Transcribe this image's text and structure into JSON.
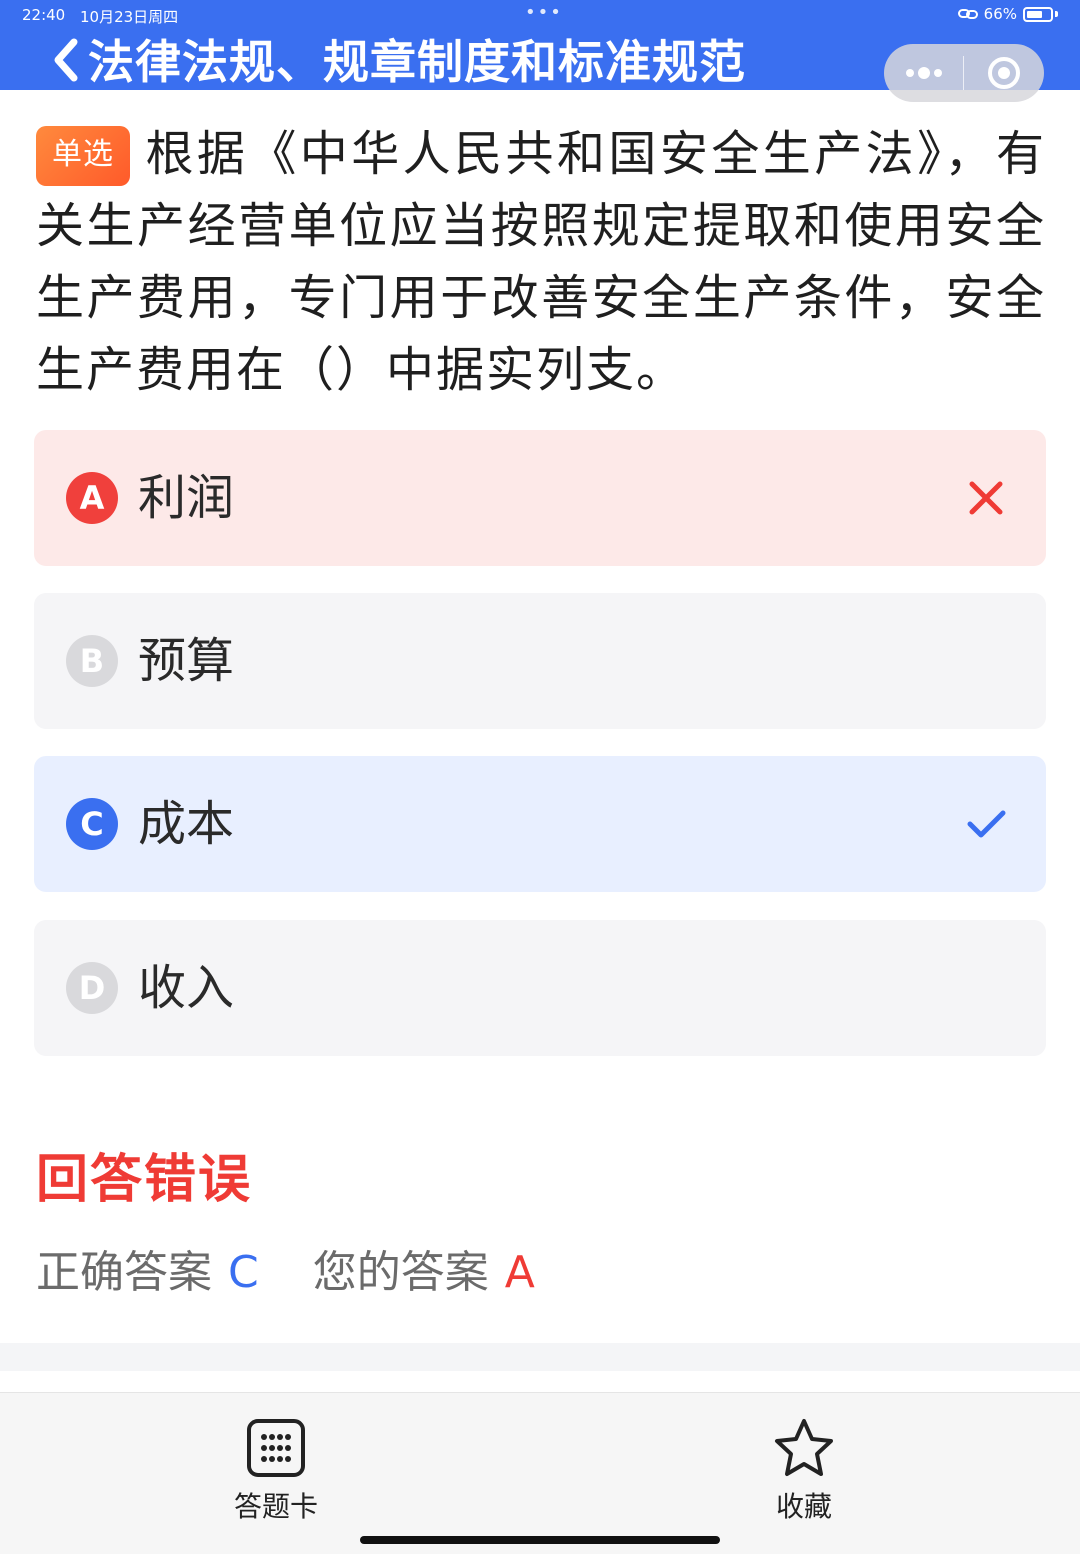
{
  "status_bar": {
    "time": "22:40",
    "date": "10月23日周四",
    "battery": "66%",
    "battery_level": 0.66
  },
  "header": {
    "title": "法律法规、规章制度和标准规范",
    "back_icon": "chevron-left-icon",
    "more_icon": "more-dots-icon",
    "close_icon": "target-close-icon"
  },
  "question": {
    "type_badge": "单选",
    "text": "根据《中华人民共和国安全生产法》，有关生产经营单位应当按照规定提取和使用安全生产费用，专门用于改善安全生产条件，安全生产费用在（）中据实列支。"
  },
  "options": [
    {
      "letter": "A",
      "text": "利润",
      "state": "wrong"
    },
    {
      "letter": "B",
      "text": "预算",
      "state": "normal"
    },
    {
      "letter": "C",
      "text": "成本",
      "state": "correct"
    },
    {
      "letter": "D",
      "text": "收入",
      "state": "normal"
    }
  ],
  "result": {
    "title": "回答错误",
    "correct_label": "正确答案",
    "correct_value": "C",
    "your_label": "您的答案",
    "your_value": "A"
  },
  "bottom_bar": {
    "answer_card_label": "答题卡",
    "favorite_label": "收藏"
  },
  "colors": {
    "primary": "#3a6ff0",
    "error": "#ef3b35",
    "badge": "#ff6a2f"
  }
}
